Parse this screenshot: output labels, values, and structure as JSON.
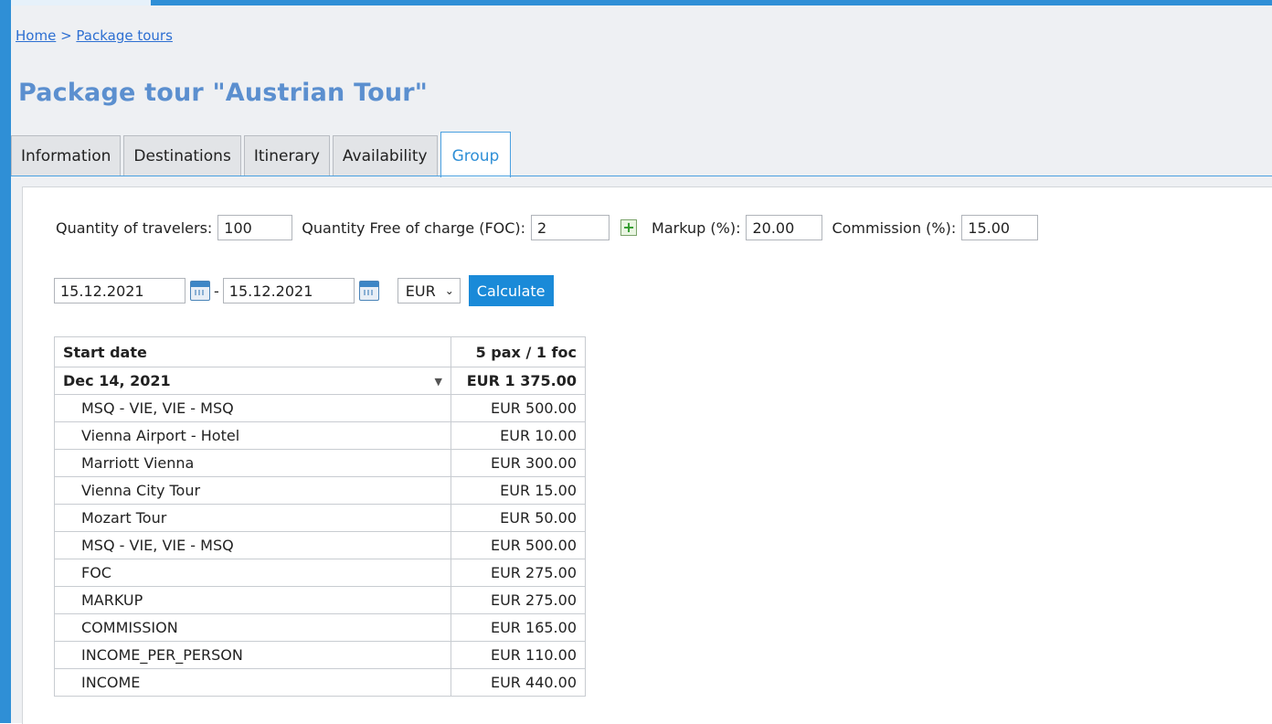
{
  "breadcrumb": {
    "home": "Home",
    "separator": " > ",
    "current": "Package tours"
  },
  "title": "Package tour \"Austrian Tour\"",
  "tabs": [
    {
      "label": "Information"
    },
    {
      "label": "Destinations"
    },
    {
      "label": "Itinerary"
    },
    {
      "label": "Availability"
    },
    {
      "label": "Group",
      "active": true
    }
  ],
  "form": {
    "travelers_label": "Quantity of travelers:",
    "travelers_value": "100",
    "foc_label": "Quantity Free of charge (FOC):",
    "foc_value": "2",
    "markup_label": "Markup (%):",
    "markup_value": "20.00",
    "commission_label": "Commission (%):",
    "commission_value": "15.00",
    "date_from": "15.12.2021",
    "date_sep": "-",
    "date_to": "15.12.2021",
    "currency": "EUR",
    "calculate_label": "Calculate"
  },
  "table": {
    "headers": [
      "Start date",
      "5 pax / 1 foc"
    ],
    "group": {
      "date": "Dec 14, 2021",
      "total": "EUR 1 375.00"
    },
    "rows": [
      {
        "name": "MSQ - VIE, VIE - MSQ",
        "amount": "EUR 500.00"
      },
      {
        "name": "Vienna Airport - Hotel",
        "amount": "EUR 10.00"
      },
      {
        "name": "Marriott Vienna",
        "amount": "EUR 300.00"
      },
      {
        "name": "Vienna City Tour",
        "amount": "EUR 15.00"
      },
      {
        "name": "Mozart Tour",
        "amount": "EUR 50.00"
      },
      {
        "name": "MSQ - VIE, VIE - MSQ",
        "amount": "EUR 500.00"
      },
      {
        "name": "FOC",
        "amount": "EUR 275.00"
      },
      {
        "name": "MARKUP",
        "amount": "EUR 275.00"
      },
      {
        "name": "COMMISSION",
        "amount": "EUR 165.00"
      },
      {
        "name": "INCOME_PER_PERSON",
        "amount": "EUR 110.00"
      },
      {
        "name": "INCOME",
        "amount": "EUR 440.00"
      }
    ]
  },
  "colors": {
    "accent": "#2f8fd6",
    "title": "#5b8fcf",
    "button": "#1a8ad8",
    "link": "#2d6fd2"
  },
  "icons": {
    "add_foc": "plus-icon",
    "calendar": "calendar-icon",
    "dropdown": "chevron-down-icon",
    "expand": "caret-down-icon"
  }
}
